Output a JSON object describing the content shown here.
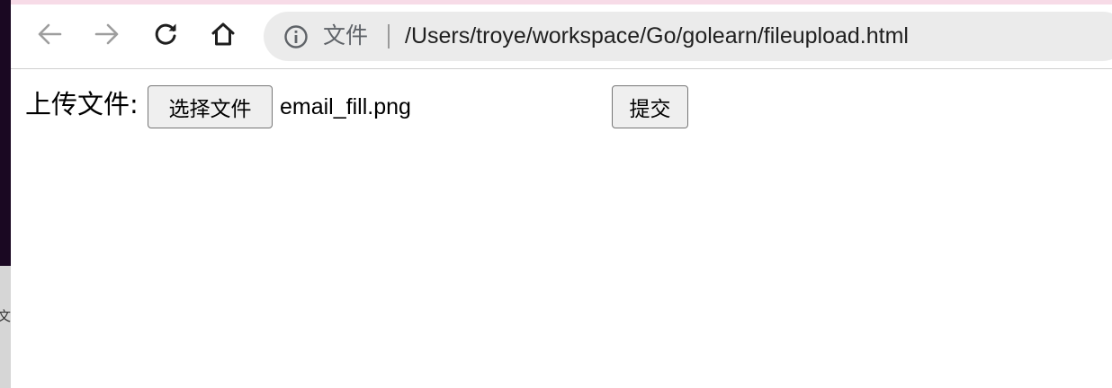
{
  "browser": {
    "nav": {
      "back_icon": "arrow-left-icon",
      "forward_icon": "arrow-right-icon",
      "reload_icon": "reload-icon",
      "home_icon": "home-icon"
    },
    "omnibox": {
      "security_icon": "info-icon",
      "scheme_label": "文件",
      "url": "/Users/troye/workspace/Go/golearn/fileupload.html"
    }
  },
  "page": {
    "upload_label": "上传文件:",
    "file_button_label": "选择文件",
    "selected_file": "email_fill.png",
    "submit_label": "提交"
  },
  "background_window": {
    "partial_glyph": "文"
  },
  "colors": {
    "top_stripe": "#f7dbe7",
    "omnibox_bg": "#ebebeb",
    "button_bg": "#efefef",
    "button_border": "#767676",
    "desktop_edge": "#1a0822"
  }
}
